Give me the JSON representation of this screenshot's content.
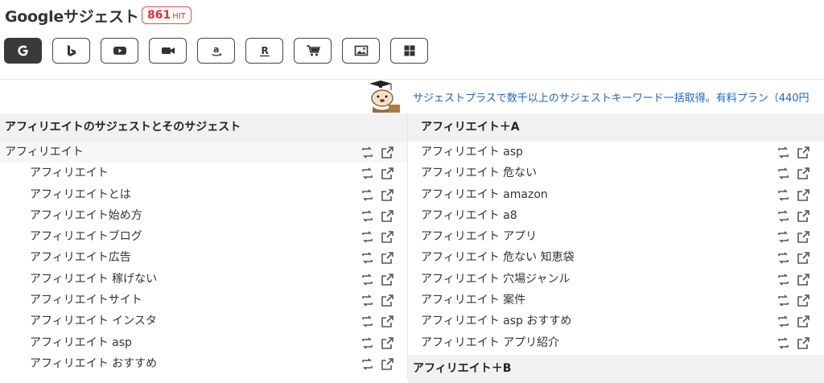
{
  "header": {
    "title": "Googleサジェスト",
    "hit_count": "861",
    "hit_unit": "HIT"
  },
  "engines": [
    {
      "name": "google",
      "icon": "google-icon",
      "active": true
    },
    {
      "name": "bing",
      "icon": "bing-icon",
      "active": false
    },
    {
      "name": "youtube",
      "icon": "youtube-icon",
      "active": false
    },
    {
      "name": "video",
      "icon": "video-camera-icon",
      "active": false
    },
    {
      "name": "amazon",
      "icon": "amazon-icon",
      "active": false
    },
    {
      "name": "rakuten",
      "icon": "rakuten-icon",
      "active": false
    },
    {
      "name": "shopping",
      "icon": "cart-icon",
      "active": false
    },
    {
      "name": "image",
      "icon": "image-icon",
      "active": false
    },
    {
      "name": "apps",
      "icon": "grid-icon",
      "active": false
    }
  ],
  "promo": {
    "text": "サジェストプラスで数千以上のサジェストキーワード一括取得。有料プラン（440円"
  },
  "left_section": {
    "heading": "アフィリエイトのサジェストとそのサジェスト",
    "root": "アフィリエイト",
    "items": [
      "アフィリエイト",
      "アフィリエイトとは",
      "アフィリエイト始め方",
      "アフィリエイトブログ",
      "アフィリエイト広告",
      "アフィリエイト 稼げない",
      "アフィリエイトサイト",
      "アフィリエイト インスタ",
      "アフィリエイト asp",
      "アフィリエイト おすすめ"
    ]
  },
  "right_section": {
    "heading": "アフィリエイト＋A",
    "items": [
      "アフィリエイト asp",
      "アフィリエイト 危ない",
      "アフィリエイト amazon",
      "アフィリエイト a8",
      "アフィリエイト アプリ",
      "アフィリエイト 危ない 知恵袋",
      "アフィリエイト 穴場ジャンル",
      "アフィリエイト 案件",
      "アフィリエイト asp おすすめ",
      "アフィリエイト アプリ紹介"
    ],
    "next_heading": "アフィリエイト＋B"
  },
  "colors": {
    "hit_border": "#d9534f",
    "promo_link": "#1a66c8",
    "active_button": "#3a3a3a",
    "section_header_bg": "#f1f1f1"
  }
}
